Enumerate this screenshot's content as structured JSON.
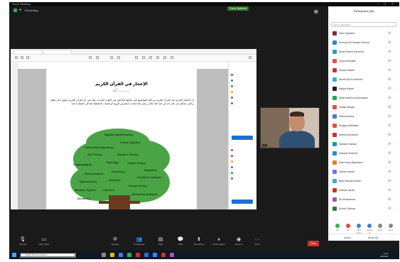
{
  "window": {
    "title": "Zoom Meeting",
    "view_options": "View Options"
  },
  "meeting": {
    "recording": "Recording..."
  },
  "document": {
    "title": "الإعجاز في القرآن الكريم",
    "subtitle": "أ.د. ............",
    "body": "إن الإعجاز العددي في القرآن الكريم من أهم المواضيع التي تناولها الباحثون في العصر الحديث، وقد تبين أن القرآن الكريم يحتوي على نظام رياضي محكم يدل على أنه من عند الله تعالى، وفي هذا البحث نستعرض فروع الرياضيات المختلفة كما في الشكل أدناه.",
    "tree_words": [
      "Algebra Mathematics",
      "Linear Algebra",
      "Differential Equations",
      "Set Theory",
      "Number Theory",
      "Cryptography",
      "Topology",
      "Graph Theory",
      "Statistics",
      "Real Analysis",
      "Geometry",
      "Complex Analysis",
      "Trigonometry",
      "Analysis",
      "Group Theory",
      "Number System",
      "Calculus",
      "Numerical Analysis",
      "Geometry"
    ]
  },
  "webcam": {
    "name": "..."
  },
  "participants": {
    "header": "Participants (68)",
    "search_placeholder": "Find a participant",
    "list": [
      {
        "name": "Sami Alqatami",
        "color": "#7a2f2f"
      },
      {
        "name": "Sumeya Ali Hussein Ahmed",
        "color": "#1f8fcf"
      },
      {
        "name": "Abdul Wahid Hammad",
        "color": "#2e9ad0"
      },
      {
        "name": "Yahya Abdullah",
        "color": "#d9534f"
      },
      {
        "name": "Hanaa Nasser",
        "color": "#c0392b"
      },
      {
        "name": "Ahmed Ali Al-Hashimi",
        "color": "#3fa9d8"
      },
      {
        "name": "Najlaa Adhab",
        "color": "#222222"
      },
      {
        "name": "Rafat Mahmood Almusawi",
        "color": "#28a35a"
      },
      {
        "name": "Jamila Sanger",
        "color": "#d9534f"
      },
      {
        "name": "Salma Amara",
        "color": "#3f7fd1"
      },
      {
        "name": "Ruqaya Aldhafaei",
        "color": "#d9534f"
      },
      {
        "name": "Amera Mohamed",
        "color": "#c0392b"
      },
      {
        "name": "Sawsan Hassan",
        "color": "#1c9aa8"
      },
      {
        "name": "Zaharah Ibrahimi",
        "color": "#1f8fcf"
      },
      {
        "name": "Sadi Musa Alquthayin",
        "color": "#e67e22"
      },
      {
        "name": "Zainab Hasan",
        "color": "#7b6ee3"
      },
      {
        "name": "Bela Hassan Amran",
        "color": "#3fa9d8"
      },
      {
        "name": "Hassan Ismail",
        "color": "#c0392b"
      },
      {
        "name": "Ali Mohammed",
        "color": "#9b59b6"
      },
      {
        "name": "Suzan Othman",
        "color": "#2e7d32"
      }
    ],
    "reactions": [
      {
        "label": "Yes",
        "color": "#2db34a"
      },
      {
        "label": "No",
        "color": "#e04747"
      },
      {
        "label": "Slow down",
        "color": "#3f7fd1"
      },
      {
        "label": "Speed up",
        "color": "#3f7fd1"
      },
      {
        "label": "More",
        "color": "#888888"
      },
      {
        "label": "Clear",
        "color": "#888888"
      }
    ],
    "footer": {
      "invite": "Invite",
      "mute_all": "Mute All",
      "more": "..."
    }
  },
  "controls": [
    {
      "icon": "mic-icon",
      "glyph": "🎙",
      "label": "Unmute"
    },
    {
      "icon": "video-icon",
      "glyph": "▭",
      "label": "Start Video"
    },
    {
      "icon": "shield-icon",
      "glyph": "⛨",
      "label": "Security"
    },
    {
      "icon": "participants-icon",
      "glyph": "👥",
      "label": "Participants"
    },
    {
      "icon": "polls-icon",
      "glyph": "▤",
      "label": "Polls"
    },
    {
      "icon": "chat-icon",
      "glyph": "💬",
      "label": "Chat"
    },
    {
      "icon": "share-icon",
      "glyph": "⬆",
      "label": "New Share"
    },
    {
      "icon": "pause-icon",
      "glyph": "⏸",
      "label": "Pause Share"
    },
    {
      "icon": "record-icon",
      "glyph": "◉",
      "label": "Record"
    },
    {
      "icon": "more-icon",
      "glyph": "···",
      "label": "More"
    }
  ],
  "end_button": "End",
  "taskbar": {
    "search_placeholder": "Type here to search",
    "time": "12:52",
    "date": "4/8/2021"
  },
  "colors": {
    "accent_green": "#2db34a",
    "tree_green": "#4aa446",
    "end_red": "#d92b2b"
  }
}
